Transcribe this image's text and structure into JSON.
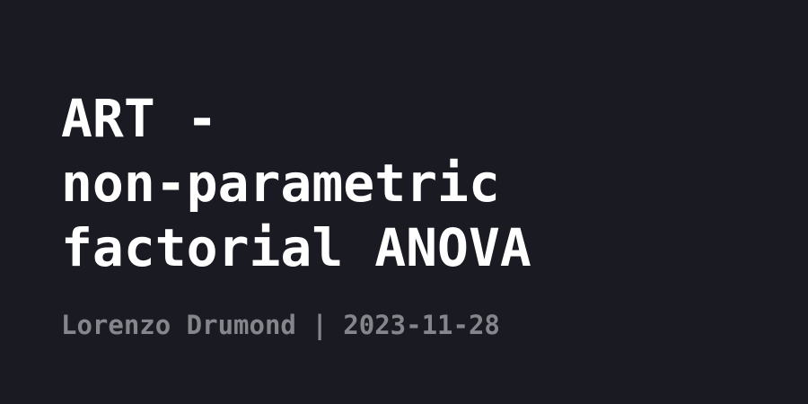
{
  "title": "ART -\nnon-parametric\nfactorial ANOVA",
  "byline": "Lorenzo Drumond | 2023-11-28",
  "colors": {
    "background": "#1a1b22",
    "title": "#ffffff",
    "byline": "#85868b"
  }
}
